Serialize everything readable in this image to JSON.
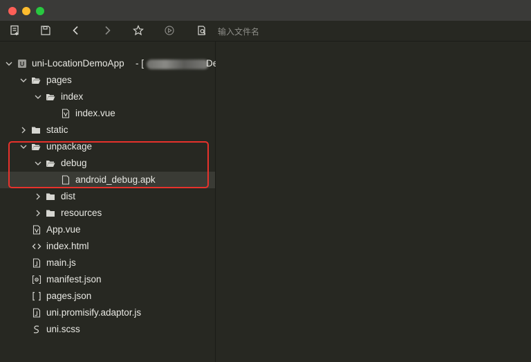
{
  "window": {
    "traffic_colors": {
      "close": "#fe5f57",
      "minimize": "#febc2e",
      "maximize": "#28c840"
    }
  },
  "toolbar": {
    "search_placeholder": "输入文件名",
    "icons": [
      "new-file-icon",
      "save-icon",
      "back-icon",
      "forward-icon",
      "star-icon",
      "run-icon",
      "search-file-icon"
    ]
  },
  "tree": {
    "project": {
      "name": "uni-LocationDemoApp",
      "suffix_visible": "- [",
      "suffix_tail": "De"
    },
    "items": [
      {
        "label": "pages",
        "type": "folder-open"
      },
      {
        "label": "index",
        "type": "folder-open"
      },
      {
        "label": "index.vue",
        "type": "vue-file"
      },
      {
        "label": "static",
        "type": "folder-closed"
      },
      {
        "label": "unpackage",
        "type": "folder-open"
      },
      {
        "label": "debug",
        "type": "folder-open"
      },
      {
        "label": "android_debug.apk",
        "type": "file"
      },
      {
        "label": "dist",
        "type": "folder-closed"
      },
      {
        "label": "resources",
        "type": "folder-closed"
      },
      {
        "label": "App.vue",
        "type": "vue-file"
      },
      {
        "label": "index.html",
        "type": "html-file"
      },
      {
        "label": "main.js",
        "type": "js-file"
      },
      {
        "label": "manifest.json",
        "type": "manifest-file"
      },
      {
        "label": "pages.json",
        "type": "json-file"
      },
      {
        "label": "uni.promisify.adaptor.js",
        "type": "js-file"
      },
      {
        "label": "uni.scss",
        "type": "scss-file"
      }
    ],
    "selected_item": "android_debug.apk",
    "highlight_color": "#e8322c"
  }
}
